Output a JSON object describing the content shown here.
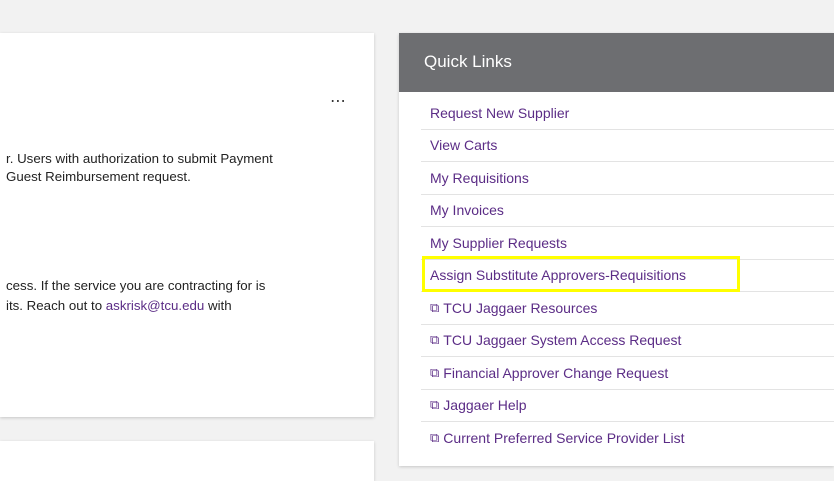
{
  "left_card": {
    "more_glyph": "⋯",
    "para1_line1": "r.  Users with authorization to submit Payment",
    "para1_line2": "Guest Reimbursement request.",
    "para2_line1": "cess.  If the service you are contracting for is",
    "para2_line2_prefix": "its.  Reach out to ",
    "para2_line2_link": "askrisk@tcu.edu",
    "para2_line2_suffix": " with"
  },
  "quick_links": {
    "title": "Quick Links",
    "external_icon": "external-link-icon",
    "items": [
      {
        "label": "Request New Supplier",
        "external": false
      },
      {
        "label": "View Carts",
        "external": false
      },
      {
        "label": "My Requisitions",
        "external": false
      },
      {
        "label": "My Invoices",
        "external": false
      },
      {
        "label": "My Supplier Requests",
        "external": false
      },
      {
        "label": "Assign Substitute Approvers-Requisitions",
        "external": false
      },
      {
        "label": "TCU Jaggaer Resources",
        "external": true
      },
      {
        "label": "TCU Jaggaer System Access Request",
        "external": true
      },
      {
        "label": "Financial Approver Change Request",
        "external": true
      },
      {
        "label": "Jaggaer Help",
        "external": true
      },
      {
        "label": "Current Preferred Service Provider List",
        "external": true
      }
    ]
  },
  "colors": {
    "link": "#5b2c86",
    "header_bg": "#6d6e71",
    "highlight": "#ffff00"
  }
}
